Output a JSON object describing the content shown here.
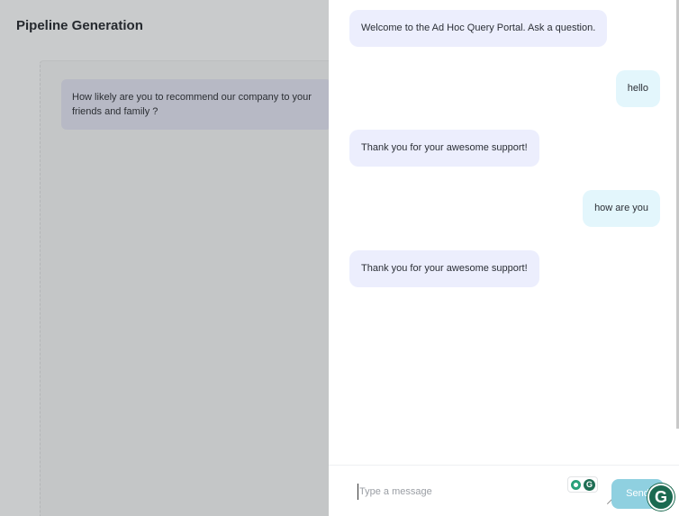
{
  "page": {
    "title": "Pipeline Generation",
    "question": "How likely are you to recommend our company to your friends and family ?"
  },
  "chat": {
    "messages": [
      {
        "role": "bot",
        "text": "Welcome to the Ad Hoc Query Portal. Ask a question."
      },
      {
        "role": "user",
        "text": "hello"
      },
      {
        "role": "bot",
        "text": "Thank you for your awesome support!"
      },
      {
        "role": "user",
        "text": "how are you"
      },
      {
        "role": "bot",
        "text": "Thank you for your awesome support!"
      }
    ],
    "input_placeholder": "Type a message",
    "send_label": "Send",
    "grammarly_letter": "G"
  },
  "colors": {
    "bot_bubble": "#eceefd",
    "user_bubble": "#e3f6fc",
    "send_button": "#8fd0e0",
    "grammarly": "#1c6a51"
  },
  "icons": [
    "lightbulb-icon",
    "grammarly-icon",
    "resize-handle-icon"
  ]
}
